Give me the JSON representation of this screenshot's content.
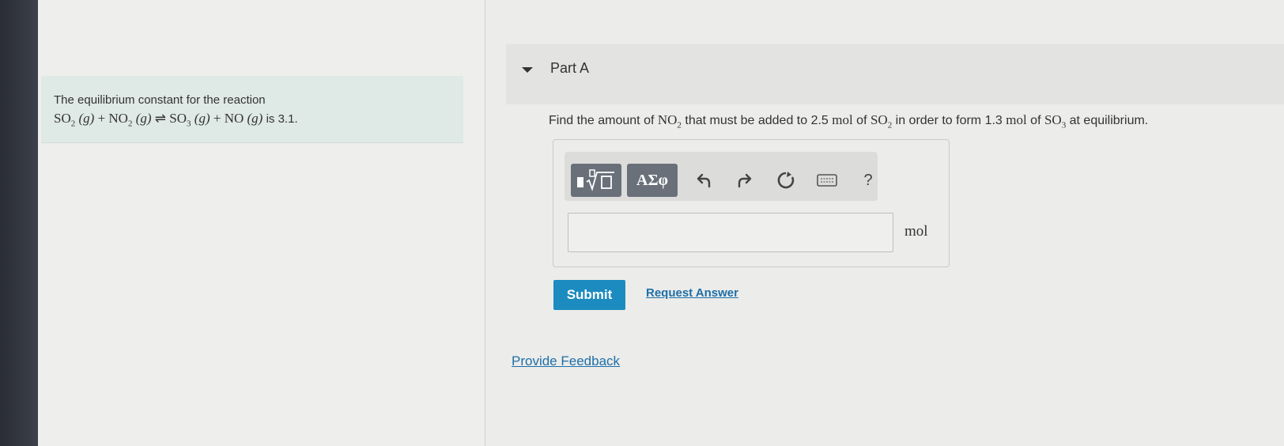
{
  "intro": {
    "line1": "The equilibrium constant for the reaction",
    "reaction": {
      "so2": "SO",
      "so2_sub": "2",
      "g1": "(g)",
      "plus1": "+",
      "no2": "NO",
      "no2_sub": "2",
      "g2": "(g)",
      "arrow": "⇌",
      "so3": "SO",
      "so3_sub": "3",
      "g3": "(g)",
      "plus2": "+",
      "no": "NO",
      "g4": "(g)"
    },
    "tail": "is 3.1."
  },
  "part_a": {
    "title": "Part A",
    "question": {
      "p1": "Find the amount of ",
      "no2": "NO",
      "no2_sub": "2",
      "p2": " that must be added to 2.5 ",
      "mol1": "mol",
      "p3": " of ",
      "so2": "SO",
      "so2_sub": "2",
      "p4": " in order to form 1.3 ",
      "mol2": "mol",
      "p5": " of ",
      "so3": "SO",
      "so3_sub": "3",
      "p6": " at equilibrium."
    },
    "toolbar": {
      "greek_label": "ΑΣφ",
      "help_label": "?"
    },
    "answer": {
      "value": "",
      "unit": "mol"
    },
    "submit_label": "Submit",
    "request_answer_label": "Request Answer"
  },
  "provide_feedback_label": "Provide Feedback",
  "colors": {
    "submit": "#1c8bc0",
    "link": "#1e6fa8",
    "intro_bg": "#dfe9e6",
    "toolbar_button": "#69707a"
  }
}
